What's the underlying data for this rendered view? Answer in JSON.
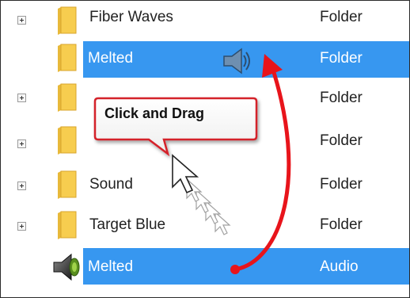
{
  "rows": [
    {
      "name": "Fiber Waves",
      "type": "Folder",
      "expander": true,
      "selected": false,
      "icon": "folder-icon"
    },
    {
      "name": "Melted",
      "type": "Folder",
      "expander": false,
      "selected": true,
      "icon": "folder-icon"
    },
    {
      "name": "",
      "type": "Folder",
      "expander": true,
      "selected": false,
      "icon": "folder-icon"
    },
    {
      "name": "",
      "type": "Folder",
      "expander": true,
      "selected": false,
      "icon": "folder-icon"
    },
    {
      "name": "Sound",
      "type": "Folder",
      "expander": true,
      "selected": false,
      "icon": "folder-icon"
    },
    {
      "name": "Target Blue",
      "type": "Folder",
      "expander": true,
      "selected": false,
      "icon": "folder-icon"
    },
    {
      "name": "Melted",
      "type": "Audio",
      "expander": false,
      "selected": true,
      "icon": "speaker-icon"
    }
  ],
  "callout": {
    "text": "Click and Drag"
  },
  "colors": {
    "selection": "#3797f0",
    "arrow": "#e8141b",
    "callout_border": "#d4202a",
    "folder": "#f5c742"
  }
}
